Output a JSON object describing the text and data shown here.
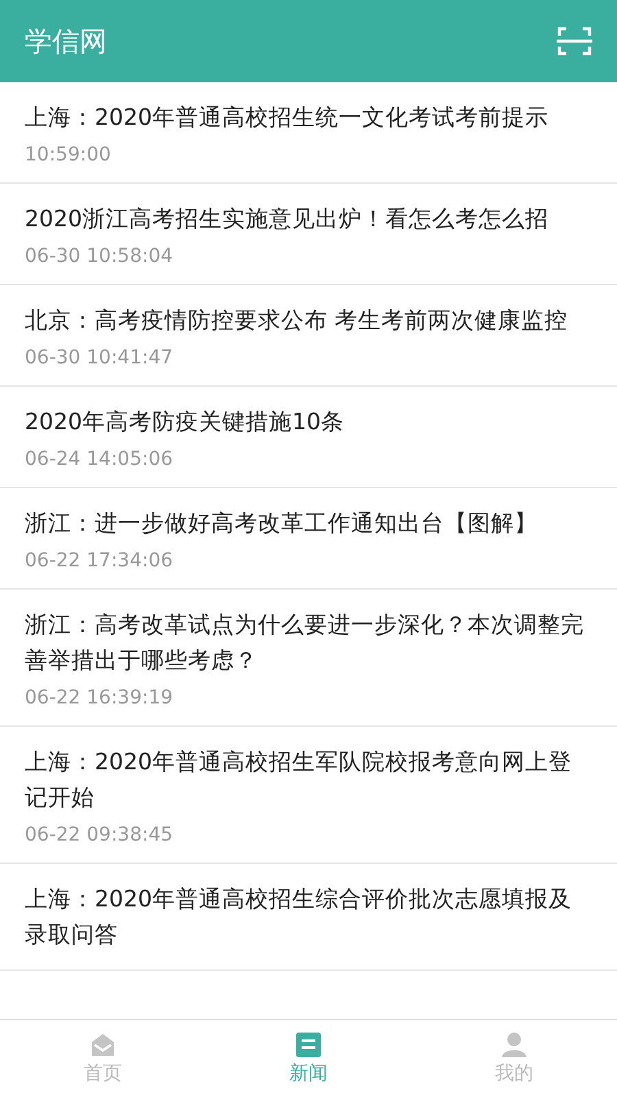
{
  "header": {
    "title": "学信网"
  },
  "news": [
    {
      "title": "上海：2020年普通高校招生统一文化考试考前提示",
      "time": "10:59:00"
    },
    {
      "title": "2020浙江高考招生实施意见出炉！看怎么考怎么招",
      "time": "06-30 10:58:04"
    },
    {
      "title": "北京：高考疫情防控要求公布  考生考前两次健康监控",
      "time": "06-30 10:41:47"
    },
    {
      "title": "2020年高考防疫关键措施10条",
      "time": "06-24 14:05:06"
    },
    {
      "title": "浙江：进一步做好高考改革工作通知出台【图解】",
      "time": "06-22 17:34:06"
    },
    {
      "title": "浙江：高考改革试点为什么要进一步深化？本次调整完善举措出于哪些考虑？",
      "time": "06-22 16:39:19"
    },
    {
      "title": "上海：2020年普通高校招生军队院校报考意向网上登记开始",
      "time": "06-22 09:38:45"
    },
    {
      "title": "上海：2020年普通高校招生综合评价批次志愿填报及录取问答"
    }
  ],
  "tabs": [
    {
      "label": "首页",
      "kind": "home",
      "selected": false
    },
    {
      "label": "新闻",
      "kind": "news",
      "selected": true
    },
    {
      "label": "我的",
      "kind": "profile",
      "selected": false
    }
  ]
}
